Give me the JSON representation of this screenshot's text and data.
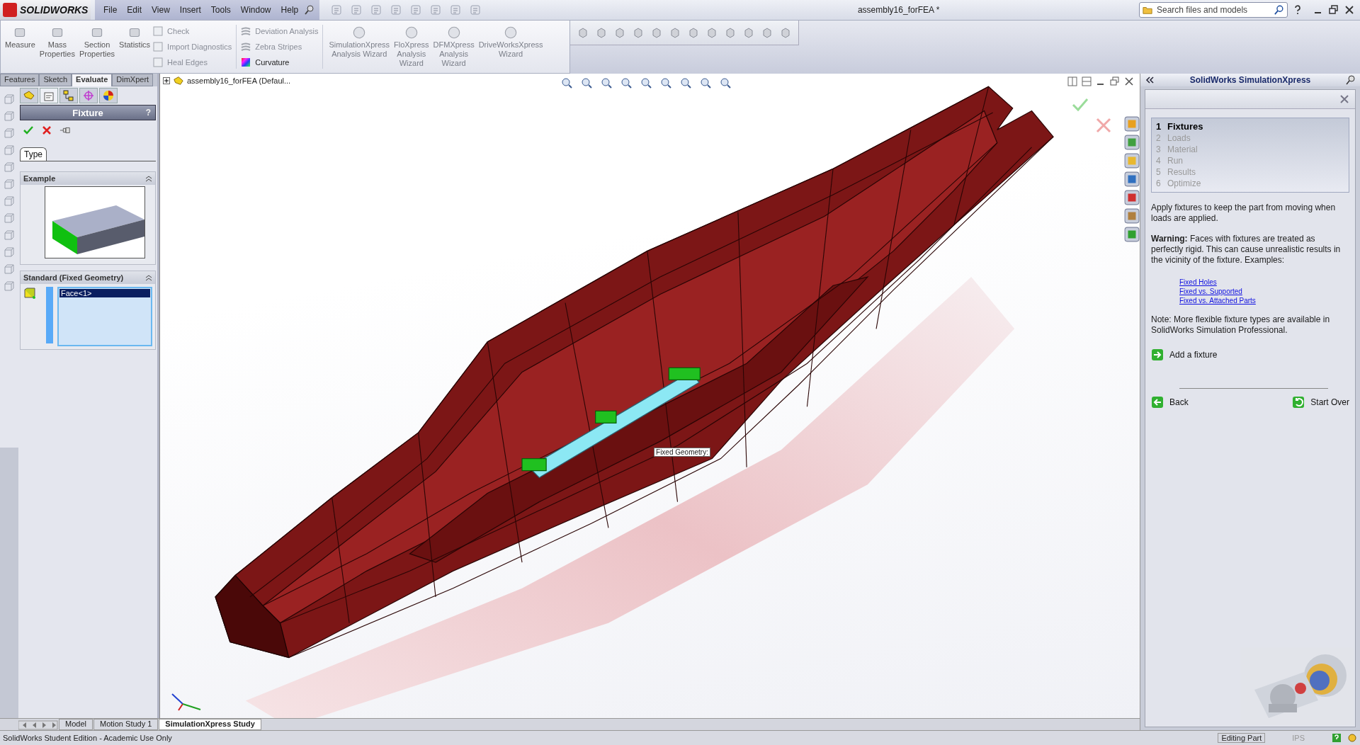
{
  "app": {
    "logo": "SOLIDWORKS",
    "menu": [
      "File",
      "Edit",
      "View",
      "Insert",
      "Tools",
      "Window",
      "Help"
    ],
    "document_title": "assembly16_forFEA *",
    "search": {
      "placeholder": "Search files and models"
    }
  },
  "command_manager": {
    "large_buttons": [
      {
        "label": "Measure"
      },
      {
        "label": "Mass\nProperties"
      },
      {
        "label": "Section\nProperties"
      },
      {
        "label": "Statistics"
      }
    ],
    "small_buttons": [
      {
        "label": "Check"
      },
      {
        "label": "Import Diagnostics"
      },
      {
        "label": "Heal Edges"
      }
    ],
    "analysis_buttons": [
      {
        "label": "Deviation Analysis",
        "disabled": true
      },
      {
        "label": "Zebra Stripes",
        "disabled": true
      },
      {
        "label": "Curvature",
        "disabled": false
      }
    ],
    "wizards": [
      {
        "label": "SimulationXpress\nAnalysis Wizard"
      },
      {
        "label": "FloXpress\nAnalysis\nWizard"
      },
      {
        "label": "DFMXpress\nAnalysis\nWizard"
      },
      {
        "label": "DriveWorksXpress\nWizard"
      }
    ]
  },
  "tabs": [
    {
      "label": "Features",
      "selected": false
    },
    {
      "label": "Sketch",
      "selected": false
    },
    {
      "label": "Evaluate",
      "selected": true
    },
    {
      "label": "DimXpert",
      "selected": false
    }
  ],
  "property_manager": {
    "title": "Fixture",
    "help": "?",
    "tabs": [
      {
        "label": "Type",
        "selected": true
      }
    ],
    "example": {
      "title": "Example"
    },
    "standard": {
      "title": "Standard (Fixed Geometry)",
      "selection": [
        {
          "label": "Face<1>",
          "selected": true
        }
      ]
    }
  },
  "tree": {
    "root": "assembly16_forFEA  (Defaul...",
    "expanded": false
  },
  "viewport": {
    "callout": "Fixed Geometry:"
  },
  "task_pane": {
    "title": "SolidWorks SimulationXpress",
    "steps": [
      {
        "number": "1",
        "label": "Fixtures",
        "selected": true
      },
      {
        "number": "2",
        "label": "Loads",
        "selected": false
      },
      {
        "number": "3",
        "label": "Material",
        "selected": false
      },
      {
        "number": "4",
        "label": "Run",
        "selected": false
      },
      {
        "number": "5",
        "label": "Results",
        "selected": false
      },
      {
        "number": "6",
        "label": "Optimize",
        "selected": false
      }
    ],
    "intro": "Apply fixtures to keep the part from moving when loads are applied.",
    "warning": "**Warning:** Faces with fixtures are treated as perfectly rigid. This can cause unrealistic results in the vicinity of the fixture. Examples:",
    "links": [
      "Fixed Holes",
      "Fixed vs. Supported",
      "Fixed vs. Attached Parts"
    ],
    "note": "Note: More flexible fixture types are available in SolidWorks Simulation Professional.",
    "action": "Add a fixture",
    "back": "Back",
    "start_over": "Start Over"
  },
  "study_tabs": [
    {
      "label": "Model",
      "selected": false
    },
    {
      "label": "Motion Study 1",
      "selected": false
    },
    {
      "label": "SimulationXpress Study",
      "selected": true
    }
  ],
  "status_bar": {
    "text": "SolidWorks Student Edition - Academic Use Only",
    "mode": "Editing Part",
    "units": "IPS"
  }
}
